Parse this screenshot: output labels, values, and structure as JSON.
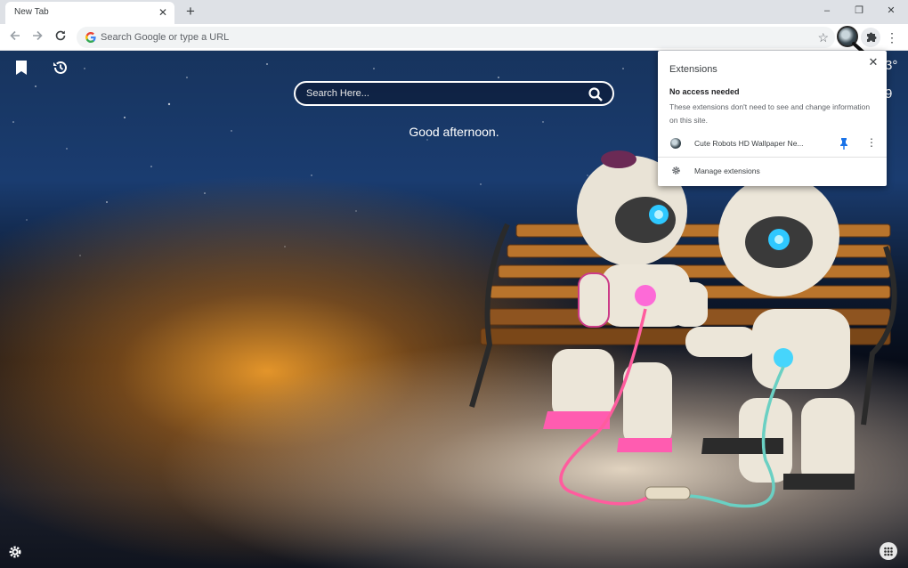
{
  "tab": {
    "title": "New Tab",
    "close_icon": "close-icon",
    "new_tab_icon": "plus-icon"
  },
  "window_controls": {
    "minimize": "–",
    "restore": "❐",
    "close": "✕"
  },
  "toolbar": {
    "back_icon": "arrow-left-icon",
    "forward_icon": "arrow-right-icon",
    "reload_icon": "reload-icon",
    "omnibox_placeholder": "Search Google or type a URL",
    "star_icon": "star-icon",
    "extensions_icon": "puzzle-icon",
    "menu_icon": "kebab-menu-icon"
  },
  "newtab_page": {
    "search_placeholder": "Search Here...",
    "greeting": "Good afternoon.",
    "weather_partial_top": "3°",
    "weather_partial_bottom": "9"
  },
  "extensions_popup": {
    "title": "Extensions",
    "section_heading": "No access needed",
    "section_description": "These extensions don't need to see and change information on this site.",
    "items": [
      {
        "name": "Cute Robots HD Wallpaper Ne...",
        "pinned": true
      }
    ],
    "manage_label": "Manage extensions"
  },
  "colors": {
    "pin_blue": "#1a73e8",
    "tabstrip_bg": "#dee1e6",
    "omnibox_bg": "#f1f3f4"
  }
}
